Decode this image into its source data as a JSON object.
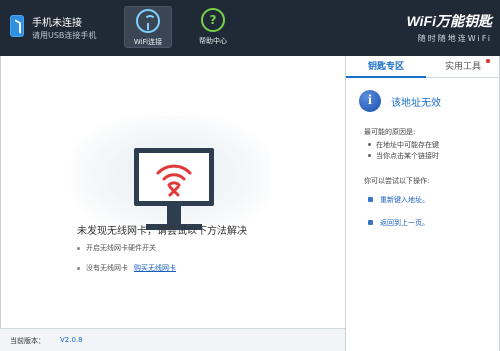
{
  "header": {
    "phone_title": "手机未连接",
    "phone_subtitle": "请用USB连接手机",
    "nav": [
      {
        "label": "WiFi连接",
        "icon": "wifi-icon",
        "active": true
      },
      {
        "label": "帮助中心",
        "icon": "help-icon",
        "active": false
      }
    ],
    "brand_title": "WiFi万能钥匙",
    "brand_slogan": "随时随地连WiFi"
  },
  "main": {
    "illustration": "monitor-wifi-error-icon",
    "error_title": "未发现无线网卡，请尝试以下方法解决",
    "tips": [
      {
        "text": "开启无线网卡硬件开关"
      },
      {
        "text": "没有无线网卡",
        "link": "购买无线网卡"
      }
    ]
  },
  "sidebar": {
    "tabs": [
      {
        "label": "钥匙专区",
        "active": true
      },
      {
        "label": "实用工具",
        "active": false,
        "badge": "red-dot"
      }
    ],
    "info_title": "该地址无效",
    "cause_heading": "最可能的原因是:",
    "causes": [
      "在地址中可能存在键",
      "当你点击某个链接时"
    ],
    "try_heading": "你可以尝试以下操作:",
    "actions": [
      "重新键入地址。",
      "返回到上一页。"
    ]
  },
  "statusbar": {
    "version_label": "当前版本：",
    "version_value": "V2.0.8"
  },
  "colors": {
    "titlebar_bg": "#1f2a36",
    "accent_blue": "#1a6fc8",
    "wifi_error_red": "#e03a3a",
    "monitor": "#2c3e50"
  }
}
